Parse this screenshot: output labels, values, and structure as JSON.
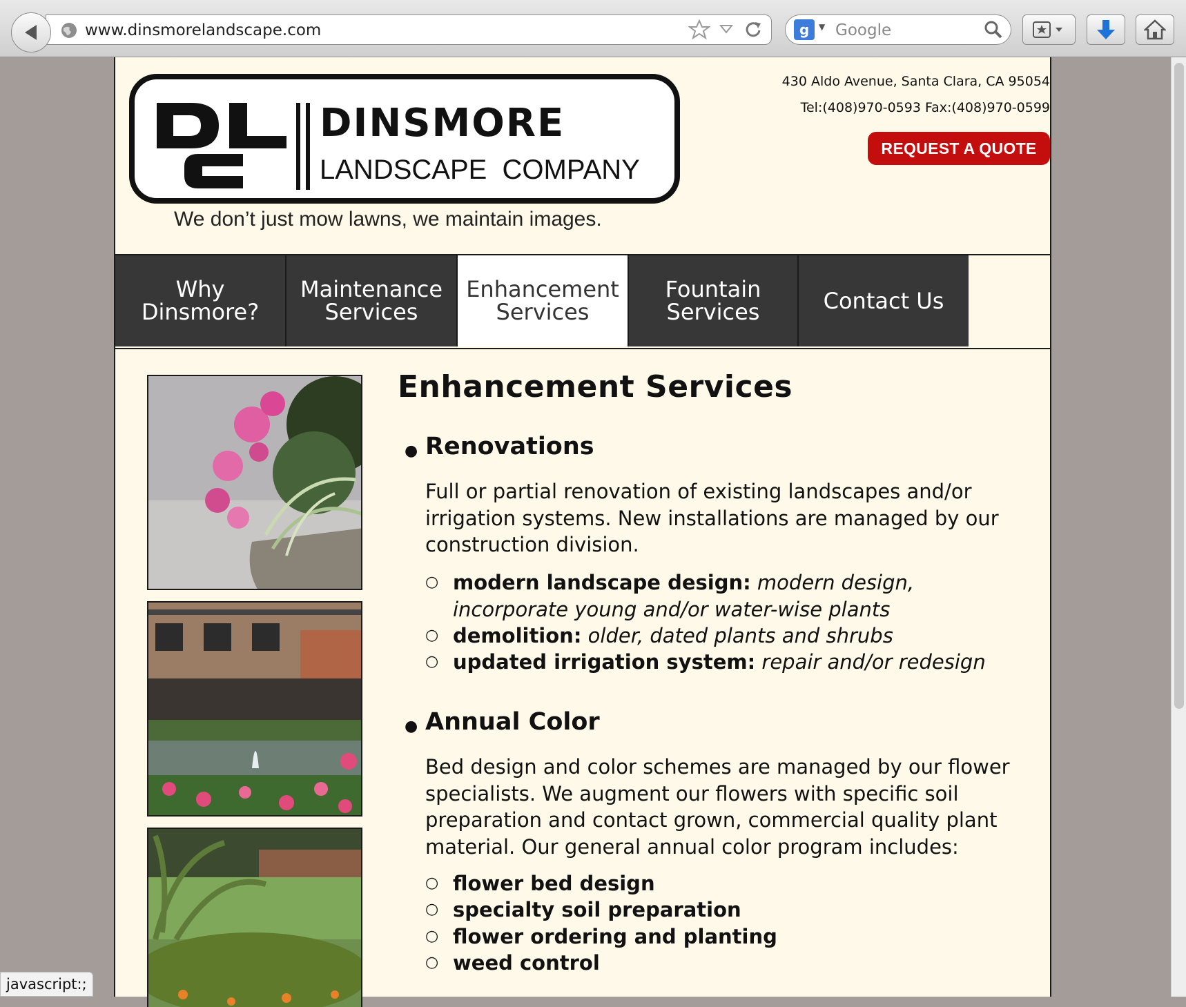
{
  "browser": {
    "url": "www.dinsmorelandscape.com",
    "search_placeholder": "Google",
    "search_engine_icon": "g"
  },
  "header": {
    "logo": {
      "company_word": "DINSMORE",
      "sub_word": "LANDSCAPE  COMPANY"
    },
    "tagline": "We don’t just mow lawns, we maintain images.",
    "address": "430 Aldo Avenue, Santa Clara, CA 95054",
    "phone": "Tel:(408)970-0593 Fax:(408)970-0599",
    "quote_button": "REQUEST A QUOTE"
  },
  "nav": {
    "items": [
      {
        "label": "Why Dinsmore?",
        "active": false
      },
      {
        "label": "Maintenance Services",
        "active": false
      },
      {
        "label": "Enhancement Services",
        "active": true
      },
      {
        "label": "Fountain Services",
        "active": false
      },
      {
        "label": "Contact Us",
        "active": false
      }
    ]
  },
  "main": {
    "title": "Enhancement Services",
    "sections": [
      {
        "title": "Renovations",
        "paragraph": "Full or partial renovation of existing landscapes and/or irrigation systems. New installations are managed by our construction division.",
        "items": [
          {
            "bold": "modern landscape design:",
            "italic": "modern design, incorporate young and/or water-wise plants"
          },
          {
            "bold": "demolition:",
            "italic": "older, dated plants and shrubs"
          },
          {
            "bold": "updated irrigation system:",
            "italic": "repair and/or redesign"
          }
        ]
      },
      {
        "title": "Annual Color",
        "paragraph": "Bed design and color schemes are managed by our flower specialists. We augment our flowers with specific soil preparation and contact grown, commercial quality plant material. Our general annual color program includes:",
        "items": [
          {
            "bold": "flower bed design"
          },
          {
            "bold": "specialty soil preparation"
          },
          {
            "bold": "flower ordering and planting"
          },
          {
            "bold": "weed control"
          }
        ]
      }
    ]
  },
  "status_bar": "javascript:;",
  "colors": {
    "page_bg": "#fef9e8",
    "nav_bg": "#373737",
    "quote_red": "#c40e0e",
    "outer_bg": "#a39c98"
  }
}
